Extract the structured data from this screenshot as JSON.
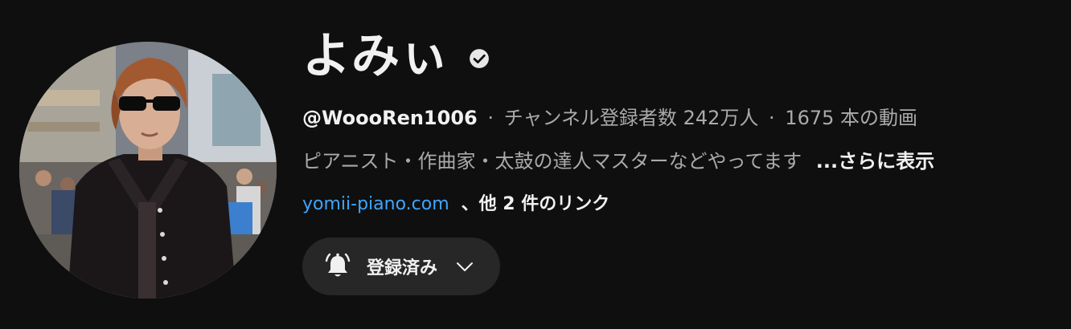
{
  "channel": {
    "name": "よみぃ",
    "handle": "@WoooRen1006",
    "subscribers": "チャンネル登録者数 242万人",
    "videos": "1675 本の動画",
    "separator": "·",
    "description": "ピアニスト・作曲家・太鼓の達人マスターなどやってます",
    "more_label": "...さらに表示",
    "link_text": "yomii-piano.com",
    "more_links_label": "、他 2 件のリンク",
    "subscribe_label": "登録済み",
    "verified": true
  },
  "icons": {
    "verified": "verified-check-icon",
    "bell": "bell-icon",
    "chevron": "chevron-down-icon",
    "avatar": "avatar"
  },
  "colors": {
    "background": "#0f0f0f",
    "text_primary": "#f1f1f1",
    "text_secondary": "#aaaaaa",
    "link": "#3ea6ff",
    "button_bg": "#272727"
  }
}
